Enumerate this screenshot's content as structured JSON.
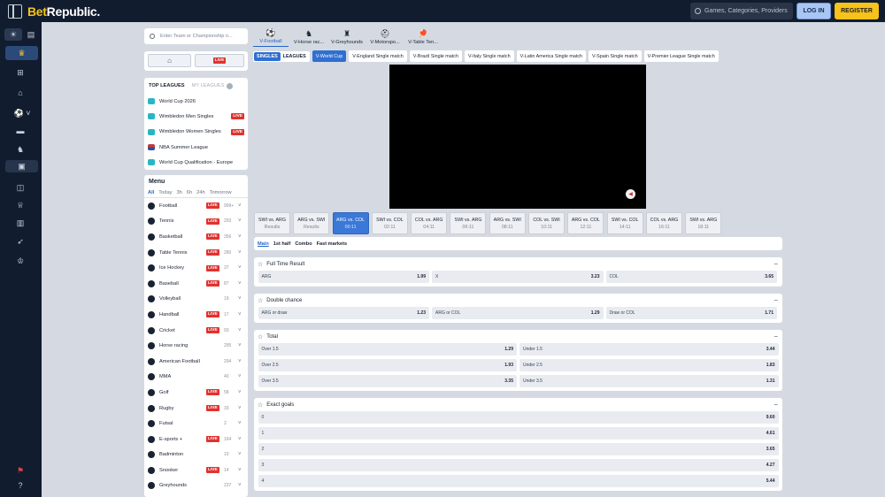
{
  "header": {
    "logo_a": "Bet",
    "logo_b": "Republic.",
    "search_placeholder": "Games, Categories, Providers",
    "login": "LOG IN",
    "register": "REGISTER"
  },
  "rail": {
    "icons": [
      "sun-icon",
      "note-icon",
      "trophy-icon",
      "gift-icon",
      "home-icon",
      "football-icon",
      "card-icon",
      "horse-icon",
      "screen-icon",
      "basket-icon",
      "trophy-outline-icon",
      "chart-icon",
      "rocket-icon",
      "crown-icon",
      "flag-icon",
      "help-icon"
    ]
  },
  "left": {
    "search_placeholder": "Enter Team or Championship n...",
    "live": "LIVE",
    "top_leagues": {
      "title": "TOP LEAGUES",
      "mine": "MY LEAGUES",
      "items": [
        {
          "label": "World Cup 2026",
          "live": ""
        },
        {
          "label": "Wimbledon Men Singles",
          "live": "LIVE"
        },
        {
          "label": "Wimbledon Women Singles",
          "live": "LIVE"
        },
        {
          "label": "NBA Summer League",
          "live": ""
        },
        {
          "label": "World Cup Qualification - Europe",
          "live": ""
        }
      ]
    },
    "menu": {
      "title": "Menu",
      "filters": [
        "All",
        "Today",
        "3h",
        "6h",
        "24h",
        "Tomorrow"
      ],
      "items": [
        {
          "label": "Football",
          "live": "LIVE",
          "count": "999+"
        },
        {
          "label": "Tennis",
          "live": "LIVE",
          "count": "293"
        },
        {
          "label": "Basketball",
          "live": "LIVE",
          "count": "356"
        },
        {
          "label": "Table Tennis",
          "live": "LIVE",
          "count": "280"
        },
        {
          "label": "Ice Hockey",
          "live": "LIVE",
          "count": "37"
        },
        {
          "label": "Baseball",
          "live": "LIVE",
          "count": "87"
        },
        {
          "label": "Volleyball",
          "live": "",
          "count": "19"
        },
        {
          "label": "Handball",
          "live": "LIVE",
          "count": "17"
        },
        {
          "label": "Cricket",
          "live": "LIVE",
          "count": "93"
        },
        {
          "label": "Horse racing",
          "live": "",
          "count": "295"
        },
        {
          "label": "American Football",
          "live": "",
          "count": "294"
        },
        {
          "label": "MMA",
          "live": "",
          "count": "40"
        },
        {
          "label": "Golf",
          "live": "LIVE",
          "count": "58"
        },
        {
          "label": "Rugby",
          "live": "LIVE",
          "count": "33"
        },
        {
          "label": "Futsal",
          "live": "",
          "count": "2"
        },
        {
          "label": "E-sports +",
          "live": "LIVE",
          "count": "164"
        },
        {
          "label": "Badminton",
          "live": "",
          "count": "10"
        },
        {
          "label": "Snooker",
          "live": "LIVE",
          "count": "14"
        },
        {
          "label": "Greyhounds",
          "live": "",
          "count": "237"
        }
      ]
    }
  },
  "main": {
    "tabs": [
      "V-Football",
      "V-Horse rac...",
      "V-Greyhounds",
      "V-Motorspo...",
      "V-Table Ten..."
    ],
    "toggle": {
      "on": "SINGLES",
      "off": "LEAGUES"
    },
    "chips": [
      "V-World Cup",
      "V-England Single match",
      "V-Brazil Single match",
      "V-Italy Single match",
      "V-Latin America Single match",
      "V-Spain Single match",
      "V-Premier League Single match"
    ],
    "matches": [
      {
        "title": "SWI vs. ARG",
        "sub": "Results"
      },
      {
        "title": "ARG vs. SWI",
        "sub": "Results"
      },
      {
        "title": "ARG vs. COL",
        "sub": "00:11"
      },
      {
        "title": "SWI vs. COL",
        "sub": "02:11"
      },
      {
        "title": "COL vs. ARG",
        "sub": "04:11"
      },
      {
        "title": "SWI vs. ARG",
        "sub": "06:11"
      },
      {
        "title": "ARG vs. SWI",
        "sub": "08:11"
      },
      {
        "title": "COL vs. SWI",
        "sub": "10:11"
      },
      {
        "title": "ARG vs. COL",
        "sub": "12:11"
      },
      {
        "title": "SWI vs. COL",
        "sub": "14:11"
      },
      {
        "title": "COL vs. ARG",
        "sub": "16:11"
      },
      {
        "title": "SWI vs. ARG",
        "sub": "18:11"
      }
    ],
    "market_tabs": [
      "Main",
      "1st half",
      "Combo",
      "Fast markets"
    ],
    "markets": [
      {
        "title": "Full Time Result",
        "odds": [
          [
            "ARG",
            "1.99"
          ],
          [
            "X",
            "3.23"
          ],
          [
            "COL",
            "3.65"
          ]
        ]
      },
      {
        "title": "Double chance",
        "odds": [
          [
            "ARG or draw",
            "1.23"
          ],
          [
            "ARG or COL",
            "1.29"
          ],
          [
            "Draw or COL",
            "1.71"
          ]
        ]
      },
      {
        "title": "Total",
        "odds": [
          [
            "Over 1.5",
            "1.29"
          ],
          [
            "Under 1.5",
            "3.44"
          ],
          [
            "Over 2.5",
            "1.93"
          ],
          [
            "Under 2.5",
            "1.83"
          ],
          [
            "Over 3.5",
            "3.35"
          ],
          [
            "Under 3.5",
            "1.31"
          ]
        ]
      },
      {
        "title": "Exact goals",
        "odds": [
          [
            "0",
            "9.60"
          ],
          [
            "1",
            "4.61"
          ],
          [
            "2",
            "3.65"
          ],
          [
            "3",
            "4.27"
          ],
          [
            "4",
            "5.44"
          ]
        ]
      }
    ],
    "collapse": "−"
  },
  "colors": {
    "accent": "#2f6fd2",
    "brand": "#f6c21b",
    "live": "#e0322f",
    "dark": "#111c2e"
  }
}
